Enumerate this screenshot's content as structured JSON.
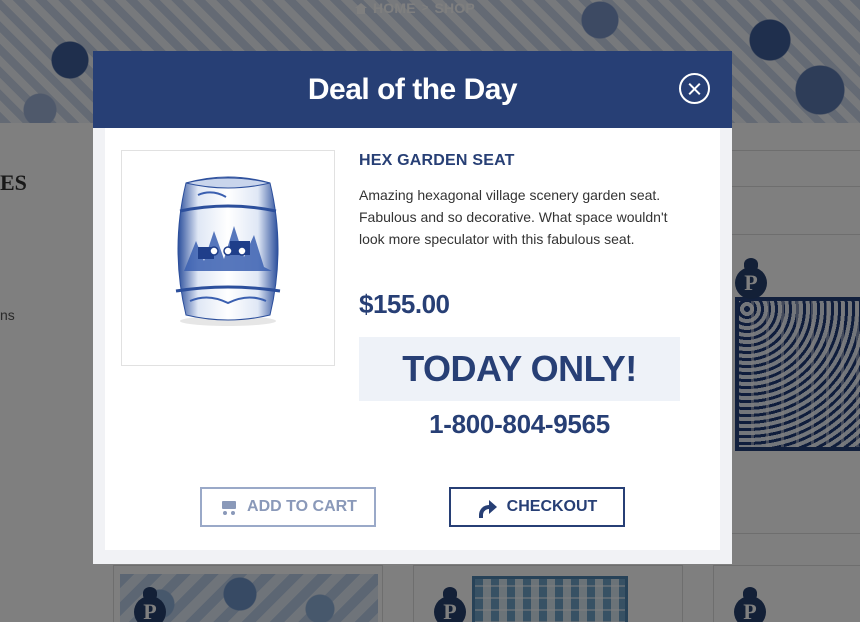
{
  "page": {
    "breadcrumb": {
      "home": "HOME",
      "separator": ">",
      "shop": "SHOP"
    },
    "sidebar": {
      "heading_fragment": "ES",
      "link_fragment": "ns"
    }
  },
  "modal": {
    "title": "Deal of the Day",
    "product": {
      "name": "HEX GARDEN SEAT",
      "description": "Amazing hexagonal village scenery garden seat. Fabulous and so decorative. What space wouldn't look more speculator with this fabulous seat.",
      "price": "$155.00"
    },
    "promo": "TODAY ONLY!",
    "phone": "1-800-804-9565",
    "buttons": {
      "add_to_cart": "ADD TO CART",
      "checkout": "CHECKOUT"
    }
  },
  "colors": {
    "navy": "#273f75",
    "light_blue_bg": "#eef2f8",
    "muted_button": "#8a99b9"
  }
}
